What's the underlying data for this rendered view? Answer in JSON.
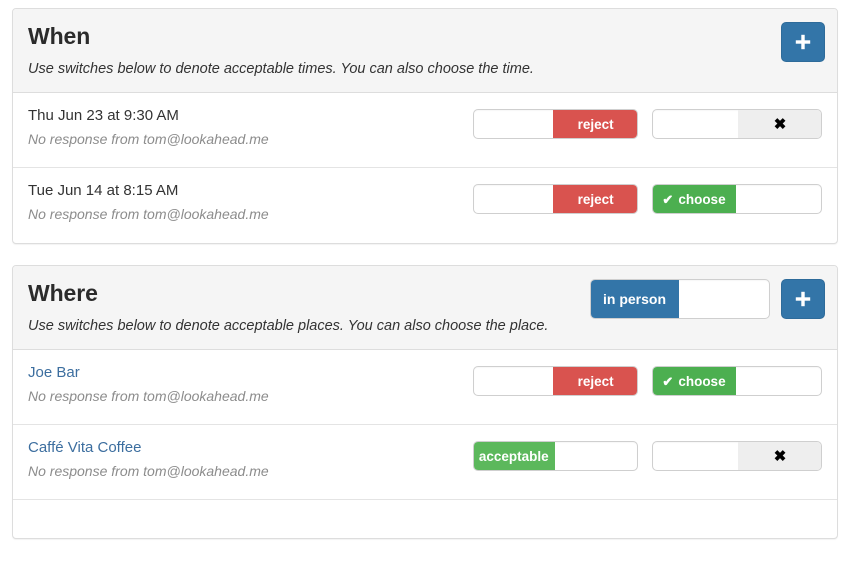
{
  "panels": [
    {
      "id": "when",
      "title": "When",
      "subtitle": "Use switches below to denote acceptable times.  You can also choose the time.",
      "add_button": {
        "label": "+",
        "icon": "plus-icon",
        "color": "#3375a8"
      },
      "rows": [
        {
          "title": "Thu Jun 23 at 9:30 AM",
          "note": "No response from tom@lookahead.me",
          "title_is_link": false,
          "switch_left": {
            "label": "reject",
            "side": "right",
            "fill_percent": 52,
            "color": "#d9534f",
            "state": "reject",
            "icon": ""
          },
          "switch_right": {
            "label": "",
            "side": "right",
            "fill_percent": 50,
            "color": "#eeeeee",
            "state": "off",
            "icon": "x-icon"
          }
        },
        {
          "title": "Tue Jun 14 at 8:15 AM",
          "note": "No response from tom@lookahead.me",
          "title_is_link": false,
          "switch_left": {
            "label": "reject",
            "side": "right",
            "fill_percent": 52,
            "color": "#d9534f",
            "state": "reject",
            "icon": ""
          },
          "switch_right": {
            "label": "choose",
            "side": "left",
            "fill_percent": 50,
            "color": "#4caf50",
            "state": "choose",
            "icon": "check-icon"
          }
        }
      ]
    },
    {
      "id": "where",
      "title": "Where",
      "subtitle": "Use switches below to denote acceptable places.  You can also choose the place.",
      "add_button": {
        "label": "+",
        "icon": "plus-icon",
        "color": "#3375a8"
      },
      "heading_switch": {
        "label": "in person",
        "side": "left",
        "fill_percent": 50,
        "color": "#3375a8",
        "state": "in-person",
        "icon": ""
      },
      "rows": [
        {
          "title": "Joe Bar",
          "note": "No response from tom@lookahead.me",
          "title_is_link": true,
          "switch_left": {
            "label": "reject",
            "side": "right",
            "fill_percent": 52,
            "color": "#d9534f",
            "state": "reject",
            "icon": ""
          },
          "switch_right": {
            "label": "choose",
            "side": "left",
            "fill_percent": 50,
            "color": "#4caf50",
            "state": "choose",
            "icon": "check-icon"
          }
        },
        {
          "title": "Caffé Vita Coffee",
          "note": "No response from tom@lookahead.me",
          "title_is_link": true,
          "switch_left": {
            "label": "acceptable",
            "side": "left",
            "fill_percent": 50,
            "color": "#5cb85c",
            "state": "acceptable",
            "icon": ""
          },
          "switch_right": {
            "label": "",
            "side": "right",
            "fill_percent": 50,
            "color": "#eeeeee",
            "state": "off",
            "icon": "x-icon"
          }
        }
      ]
    }
  ],
  "glyphs": {
    "check": "✔",
    "x": "✖",
    "plus": "+"
  }
}
